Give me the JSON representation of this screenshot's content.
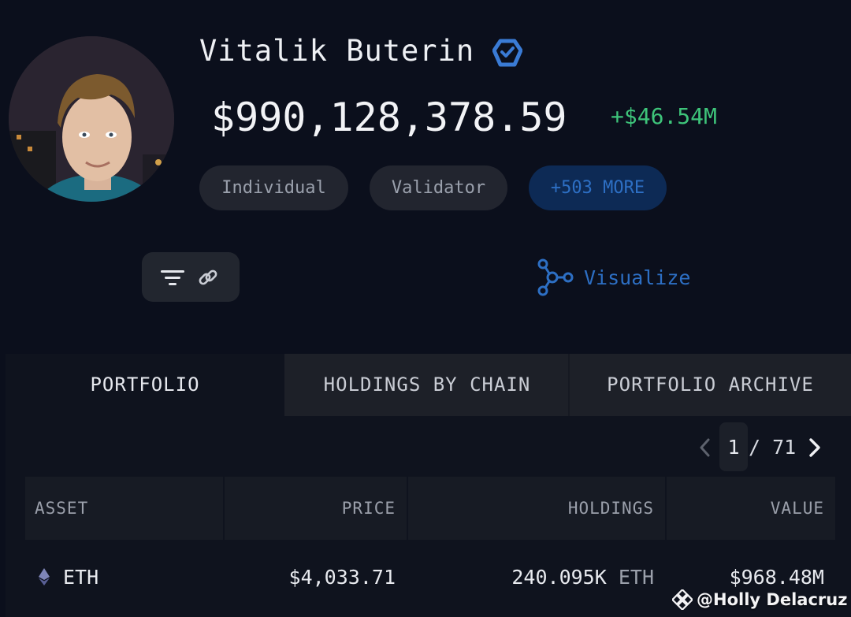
{
  "profile": {
    "name": "Vitalik Buterin",
    "total_value": "$990,128,378.59",
    "change": "+$46.54M",
    "tags": [
      "Individual",
      "Validator",
      "+503 MORE"
    ],
    "visualize_label": "Visualize"
  },
  "tabs": [
    {
      "label": "PORTFOLIO",
      "active": true
    },
    {
      "label": "HOLDINGS BY CHAIN",
      "active": false
    },
    {
      "label": "PORTFOLIO ARCHIVE",
      "active": false
    }
  ],
  "pager": {
    "current": "1",
    "of": "/ 71"
  },
  "table": {
    "headers": [
      "ASSET",
      "PRICE",
      "HOLDINGS",
      "VALUE"
    ],
    "rows": [
      {
        "asset": "ETH",
        "price": "$4,033.71",
        "holdings": "240.095K",
        "holdings_unit": "ETH",
        "value": "$968.48M"
      }
    ]
  },
  "watermark": "@Holly Delacruz",
  "colors": {
    "background": "#0b0f1c",
    "positive": "#3ec47a",
    "accent": "#2d6fc4"
  },
  "icons": [
    "verified-badge-icon",
    "filter-icon",
    "link-icon",
    "visualize-graph-icon",
    "chevron-left-icon",
    "chevron-right-icon",
    "eth-icon",
    "watermark-logo-icon"
  ]
}
